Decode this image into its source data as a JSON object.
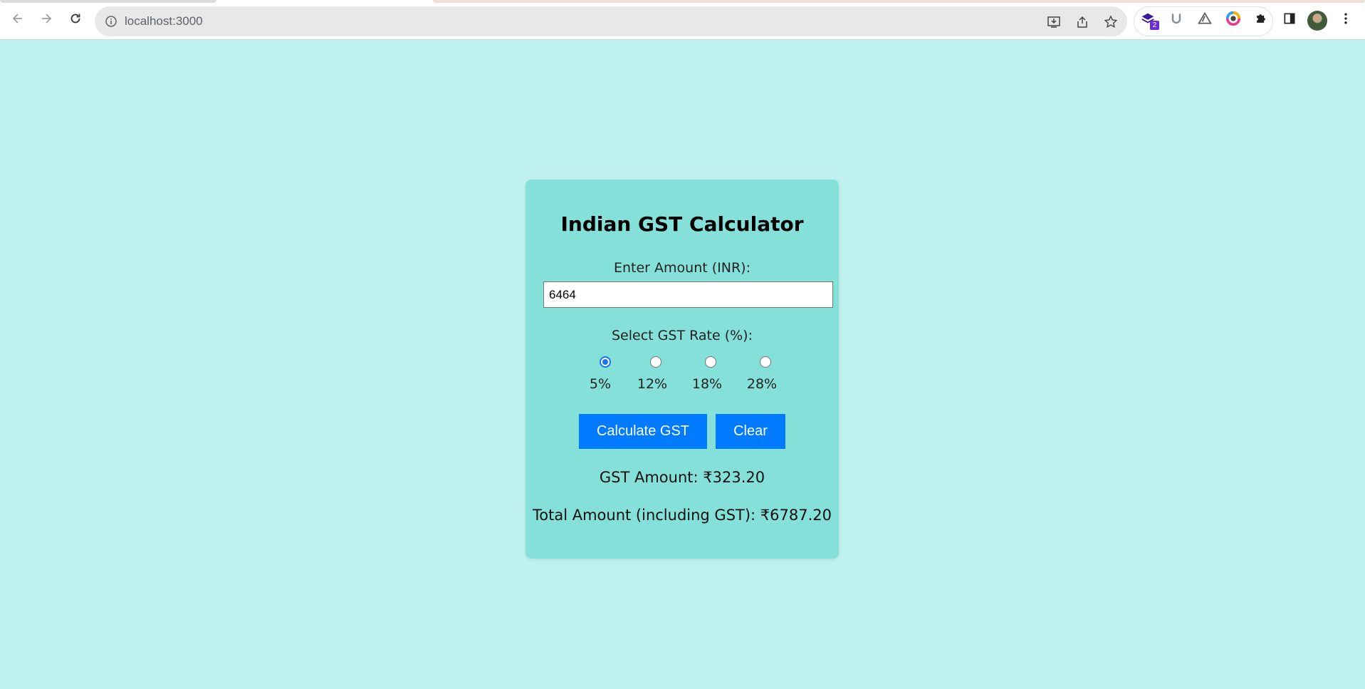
{
  "browser": {
    "url": "localhost:3000",
    "extension_badge": "2"
  },
  "card": {
    "title": "Indian GST Calculator",
    "amount_label": "Enter Amount (INR):",
    "amount_value": "6464",
    "rate_label": "Select GST Rate (%):",
    "rates": [
      "5%",
      "12%",
      "18%",
      "28%"
    ],
    "selected_rate": "5%",
    "calculate_label": "Calculate GST",
    "clear_label": "Clear",
    "gst_amount": "GST Amount: ₹323.20",
    "total_amount": "Total Amount (including GST): ₹6787.20"
  },
  "colors": {
    "page_background": "#bff2ef",
    "card_background": "#84e0d9",
    "button": "#007bff",
    "radio_accent": "#1a73e8"
  }
}
